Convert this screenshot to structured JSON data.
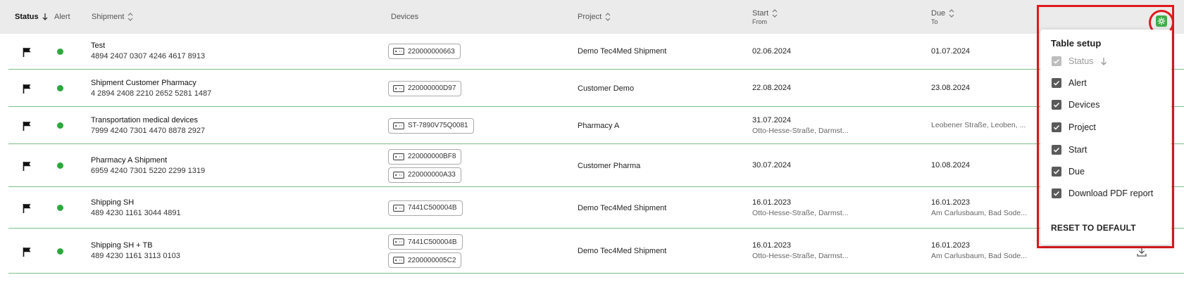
{
  "header": {
    "status": "Status",
    "alert": "Alert",
    "shipment": "Shipment",
    "devices": "Devices",
    "project": "Project",
    "start": "Start",
    "start_sub": "From",
    "due": "Due",
    "due_sub": "To"
  },
  "rows": [
    {
      "name": "Test",
      "number": "4894 2407 0307 4246 4617 8913",
      "devices": [
        "220000000663"
      ],
      "project": "Demo Tec4Med Shipment",
      "start": "02.06.2024",
      "start_loc": "",
      "due": "01.07.2024",
      "due_loc": "",
      "download": false
    },
    {
      "name": "Shipment Customer Pharmacy",
      "number": "4 2894 2408 2210 2652 5281 1487",
      "devices": [
        "220000000D97"
      ],
      "project": "Customer Demo",
      "start": "22.08.2024",
      "start_loc": "",
      "due": "23.08.2024",
      "due_loc": "",
      "download": false
    },
    {
      "name": "Transportation medical devices",
      "number": "7999 4240 7301 4470 8878 2927",
      "devices": [
        "ST-7890V75Q0081"
      ],
      "project": "Pharmacy A",
      "start": "31.07.2024",
      "start_loc": "Otto-Hesse-Straße, Darmst...",
      "due": "",
      "due_loc": "Leobener Straße, Leoben, ...",
      "download": false
    },
    {
      "name": "Pharmacy A Shipment",
      "number": "6959 4240 7301 5220 2299 1319",
      "devices": [
        "220000000BF8",
        "220000000A33"
      ],
      "project": "Customer Pharma",
      "start": "30.07.2024",
      "start_loc": "",
      "due": "10.08.2024",
      "due_loc": "",
      "download": false
    },
    {
      "name": "Shipping SH",
      "number": "489 4230 1161 3044 4891",
      "devices": [
        "7441C500004B"
      ],
      "project": "Demo Tec4Med Shipment",
      "start": "16.01.2023",
      "start_loc": "Otto-Hesse-Straße, Darmst...",
      "due": "16.01.2023",
      "due_loc": "Am Carlusbaum, Bad Sode...",
      "download": false
    },
    {
      "name": "Shipping SH + TB",
      "number": "489 4230 1161 3113 0103",
      "devices": [
        "7441C500004B",
        "2200000005C2"
      ],
      "project": "Demo Tec4Med Shipment",
      "start": "16.01.2023",
      "start_loc": "Otto-Hesse-Straße, Darmst...",
      "due": "16.01.2023",
      "due_loc": "Am Carlusbaum, Bad Sode...",
      "download": true
    }
  ],
  "table_setup": {
    "title": "Table setup",
    "options": [
      {
        "label": "Status",
        "checked": true,
        "disabled": true
      },
      {
        "label": "Alert",
        "checked": true,
        "disabled": false
      },
      {
        "label": "Devices",
        "checked": true,
        "disabled": false
      },
      {
        "label": "Project",
        "checked": true,
        "disabled": false
      },
      {
        "label": "Start",
        "checked": true,
        "disabled": false
      },
      {
        "label": "Due",
        "checked": true,
        "disabled": false
      },
      {
        "label": "Download PDF report",
        "checked": true,
        "disabled": false
      }
    ],
    "reset_label": "RESET TO DEFAULT"
  },
  "colors": {
    "accent_green": "#3fae49",
    "status_dot": "#2da83d",
    "highlight_red": "#e0191f",
    "row_divider": "#7cbf88"
  },
  "icons": {
    "status": "flag-icon",
    "alert": "status-dot",
    "device": "device-icon",
    "settings": "settings-icon",
    "download": "download-icon"
  }
}
